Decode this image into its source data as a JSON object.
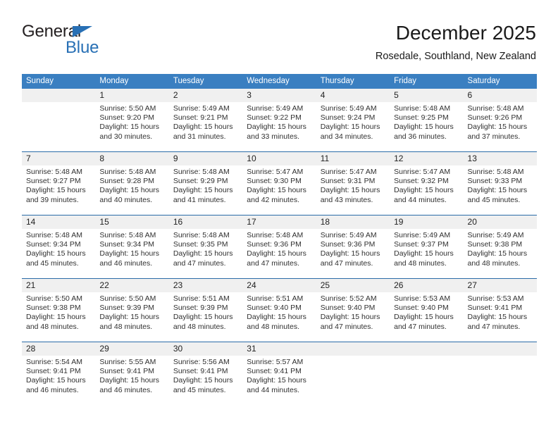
{
  "brand": {
    "name_part1": "General",
    "name_part2": "Blue",
    "accent_color": "#2870b5",
    "triangle_icon": "triangle-icon"
  },
  "header": {
    "title": "December 2025",
    "subtitle": "Rosedale, Southland, New Zealand"
  },
  "calendar": {
    "header_bg": "#3a7fc1",
    "daynum_bg": "#f0f0f0",
    "row_divider_color": "#2b6ca8",
    "weekday_headers": [
      "Sunday",
      "Monday",
      "Tuesday",
      "Wednesday",
      "Thursday",
      "Friday",
      "Saturday"
    ],
    "weeks": [
      [
        {
          "day": "",
          "lines": []
        },
        {
          "day": "1",
          "lines": [
            "Sunrise: 5:50 AM",
            "Sunset: 9:20 PM",
            "Daylight: 15 hours",
            "and 30 minutes."
          ]
        },
        {
          "day": "2",
          "lines": [
            "Sunrise: 5:49 AM",
            "Sunset: 9:21 PM",
            "Daylight: 15 hours",
            "and 31 minutes."
          ]
        },
        {
          "day": "3",
          "lines": [
            "Sunrise: 5:49 AM",
            "Sunset: 9:22 PM",
            "Daylight: 15 hours",
            "and 33 minutes."
          ]
        },
        {
          "day": "4",
          "lines": [
            "Sunrise: 5:49 AM",
            "Sunset: 9:24 PM",
            "Daylight: 15 hours",
            "and 34 minutes."
          ]
        },
        {
          "day": "5",
          "lines": [
            "Sunrise: 5:48 AM",
            "Sunset: 9:25 PM",
            "Daylight: 15 hours",
            "and 36 minutes."
          ]
        },
        {
          "day": "6",
          "lines": [
            "Sunrise: 5:48 AM",
            "Sunset: 9:26 PM",
            "Daylight: 15 hours",
            "and 37 minutes."
          ]
        }
      ],
      [
        {
          "day": "7",
          "lines": [
            "Sunrise: 5:48 AM",
            "Sunset: 9:27 PM",
            "Daylight: 15 hours",
            "and 39 minutes."
          ]
        },
        {
          "day": "8",
          "lines": [
            "Sunrise: 5:48 AM",
            "Sunset: 9:28 PM",
            "Daylight: 15 hours",
            "and 40 minutes."
          ]
        },
        {
          "day": "9",
          "lines": [
            "Sunrise: 5:48 AM",
            "Sunset: 9:29 PM",
            "Daylight: 15 hours",
            "and 41 minutes."
          ]
        },
        {
          "day": "10",
          "lines": [
            "Sunrise: 5:47 AM",
            "Sunset: 9:30 PM",
            "Daylight: 15 hours",
            "and 42 minutes."
          ]
        },
        {
          "day": "11",
          "lines": [
            "Sunrise: 5:47 AM",
            "Sunset: 9:31 PM",
            "Daylight: 15 hours",
            "and 43 minutes."
          ]
        },
        {
          "day": "12",
          "lines": [
            "Sunrise: 5:47 AM",
            "Sunset: 9:32 PM",
            "Daylight: 15 hours",
            "and 44 minutes."
          ]
        },
        {
          "day": "13",
          "lines": [
            "Sunrise: 5:48 AM",
            "Sunset: 9:33 PM",
            "Daylight: 15 hours",
            "and 45 minutes."
          ]
        }
      ],
      [
        {
          "day": "14",
          "lines": [
            "Sunrise: 5:48 AM",
            "Sunset: 9:34 PM",
            "Daylight: 15 hours",
            "and 45 minutes."
          ]
        },
        {
          "day": "15",
          "lines": [
            "Sunrise: 5:48 AM",
            "Sunset: 9:34 PM",
            "Daylight: 15 hours",
            "and 46 minutes."
          ]
        },
        {
          "day": "16",
          "lines": [
            "Sunrise: 5:48 AM",
            "Sunset: 9:35 PM",
            "Daylight: 15 hours",
            "and 47 minutes."
          ]
        },
        {
          "day": "17",
          "lines": [
            "Sunrise: 5:48 AM",
            "Sunset: 9:36 PM",
            "Daylight: 15 hours",
            "and 47 minutes."
          ]
        },
        {
          "day": "18",
          "lines": [
            "Sunrise: 5:49 AM",
            "Sunset: 9:36 PM",
            "Daylight: 15 hours",
            "and 47 minutes."
          ]
        },
        {
          "day": "19",
          "lines": [
            "Sunrise: 5:49 AM",
            "Sunset: 9:37 PM",
            "Daylight: 15 hours",
            "and 48 minutes."
          ]
        },
        {
          "day": "20",
          "lines": [
            "Sunrise: 5:49 AM",
            "Sunset: 9:38 PM",
            "Daylight: 15 hours",
            "and 48 minutes."
          ]
        }
      ],
      [
        {
          "day": "21",
          "lines": [
            "Sunrise: 5:50 AM",
            "Sunset: 9:38 PM",
            "Daylight: 15 hours",
            "and 48 minutes."
          ]
        },
        {
          "day": "22",
          "lines": [
            "Sunrise: 5:50 AM",
            "Sunset: 9:39 PM",
            "Daylight: 15 hours",
            "and 48 minutes."
          ]
        },
        {
          "day": "23",
          "lines": [
            "Sunrise: 5:51 AM",
            "Sunset: 9:39 PM",
            "Daylight: 15 hours",
            "and 48 minutes."
          ]
        },
        {
          "day": "24",
          "lines": [
            "Sunrise: 5:51 AM",
            "Sunset: 9:40 PM",
            "Daylight: 15 hours",
            "and 48 minutes."
          ]
        },
        {
          "day": "25",
          "lines": [
            "Sunrise: 5:52 AM",
            "Sunset: 9:40 PM",
            "Daylight: 15 hours",
            "and 47 minutes."
          ]
        },
        {
          "day": "26",
          "lines": [
            "Sunrise: 5:53 AM",
            "Sunset: 9:40 PM",
            "Daylight: 15 hours",
            "and 47 minutes."
          ]
        },
        {
          "day": "27",
          "lines": [
            "Sunrise: 5:53 AM",
            "Sunset: 9:41 PM",
            "Daylight: 15 hours",
            "and 47 minutes."
          ]
        }
      ],
      [
        {
          "day": "28",
          "lines": [
            "Sunrise: 5:54 AM",
            "Sunset: 9:41 PM",
            "Daylight: 15 hours",
            "and 46 minutes."
          ]
        },
        {
          "day": "29",
          "lines": [
            "Sunrise: 5:55 AM",
            "Sunset: 9:41 PM",
            "Daylight: 15 hours",
            "and 46 minutes."
          ]
        },
        {
          "day": "30",
          "lines": [
            "Sunrise: 5:56 AM",
            "Sunset: 9:41 PM",
            "Daylight: 15 hours",
            "and 45 minutes."
          ]
        },
        {
          "day": "31",
          "lines": [
            "Sunrise: 5:57 AM",
            "Sunset: 9:41 PM",
            "Daylight: 15 hours",
            "and 44 minutes."
          ]
        },
        {
          "day": "",
          "lines": []
        },
        {
          "day": "",
          "lines": []
        },
        {
          "day": "",
          "lines": []
        }
      ]
    ]
  }
}
